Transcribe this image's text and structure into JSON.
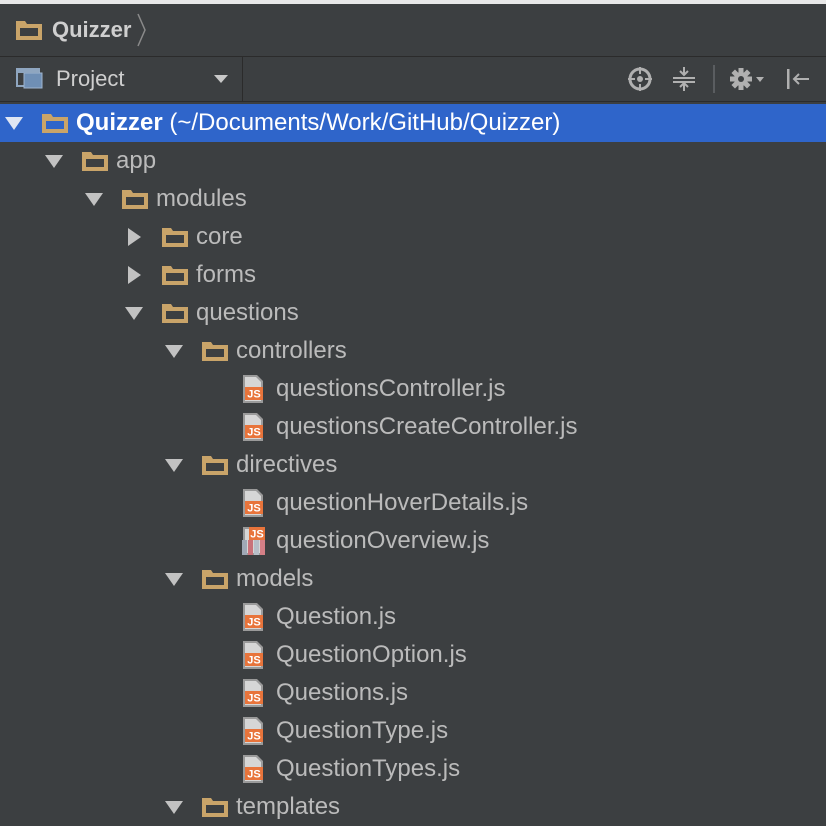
{
  "breadcrumb": {
    "label": "Quizzer"
  },
  "toolbar": {
    "view_label": "Project"
  },
  "tree": [
    {
      "label": "Quizzer",
      "path": " (~/Documents/Work/GitHub/Quizzer)",
      "kind": "folder",
      "state": "expanded",
      "level": 0,
      "selected": true
    },
    {
      "label": "app",
      "kind": "folder",
      "state": "expanded",
      "level": 1
    },
    {
      "label": "modules",
      "kind": "folder",
      "state": "expanded",
      "level": 2
    },
    {
      "label": "core",
      "kind": "folder",
      "state": "collapsed",
      "level": 3
    },
    {
      "label": "forms",
      "kind": "folder",
      "state": "collapsed",
      "level": 3
    },
    {
      "label": "questions",
      "kind": "folder",
      "state": "expanded",
      "level": 3
    },
    {
      "label": "controllers",
      "kind": "folder",
      "state": "expanded",
      "level": 4
    },
    {
      "label": "questionsController.js",
      "kind": "js",
      "level": 5
    },
    {
      "label": "questionsCreateController.js",
      "kind": "js",
      "level": 5
    },
    {
      "label": "directives",
      "kind": "folder",
      "state": "expanded",
      "level": 4
    },
    {
      "label": "questionHoverDetails.js",
      "kind": "js",
      "level": 5
    },
    {
      "label": "questionOverview.js",
      "kind": "js-mixed",
      "level": 5
    },
    {
      "label": "models",
      "kind": "folder",
      "state": "expanded",
      "level": 4
    },
    {
      "label": "Question.js",
      "kind": "js",
      "level": 5
    },
    {
      "label": "QuestionOption.js",
      "kind": "js",
      "level": 5
    },
    {
      "label": "Questions.js",
      "kind": "js",
      "level": 5
    },
    {
      "label": "QuestionType.js",
      "kind": "js",
      "level": 5
    },
    {
      "label": "QuestionTypes.js",
      "kind": "js",
      "level": 5
    },
    {
      "label": "templates",
      "kind": "folder",
      "state": "expanded",
      "level": 4
    }
  ],
  "colors": {
    "background": "#3c3f41",
    "selection": "#2f65ca",
    "folder": "#c9a469",
    "js_badge": "#e8743b",
    "text": "#bbbbbb"
  }
}
